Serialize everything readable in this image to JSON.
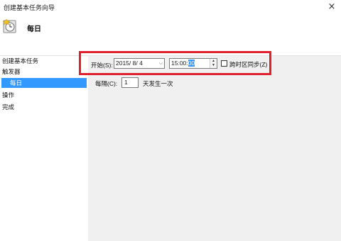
{
  "window": {
    "title": "创建基本任务向导",
    "close_glyph": "×",
    "header_icon": "task-clock-icon"
  },
  "header": {
    "title": "每日"
  },
  "nav": {
    "items": [
      {
        "label": "创建基本任务",
        "selected": false
      },
      {
        "label": "触发器",
        "selected": false
      },
      {
        "label": "每日",
        "selected": true
      },
      {
        "label": "操作",
        "selected": false
      },
      {
        "label": "完成",
        "selected": false
      }
    ]
  },
  "form": {
    "start_label": "开始(S):",
    "date_value": "2015/ 8/ 4",
    "date_caret": "⌵",
    "time_value_prefix": "15:00:",
    "time_value_selected": "00",
    "spin_up": "▲",
    "spin_down": "▼",
    "sync_label": "跨时区同步(Z)",
    "sync_checked": false,
    "recur_label": "每隔(C):",
    "recur_value": "1",
    "recur_suffix": "天发生一次"
  },
  "colors": {
    "selection": "#3399ff",
    "highlight_frame": "#e0202d",
    "panel_bg": "#f0f0f0"
  }
}
